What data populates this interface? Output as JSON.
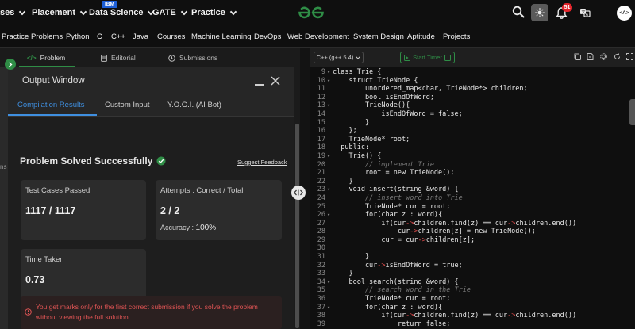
{
  "topnav": {
    "items": [
      {
        "label": "ses",
        "has_chevron": true
      },
      {
        "label": "Placement",
        "has_chevron": true
      },
      {
        "label": "Data Science",
        "has_chevron": true,
        "badge": "IBM"
      },
      {
        "label": "GATE",
        "has_chevron": true
      },
      {
        "label": "Practice",
        "has_chevron": true
      }
    ],
    "notification_count": "51",
    "avatar_text": "<A>"
  },
  "categories": [
    "Practice Problems",
    "Python",
    "C",
    "C++",
    "Java",
    "Courses",
    "Machine Learning",
    "DevOps",
    "Web Development",
    "System Design",
    "Aptitude",
    "Projects"
  ],
  "problem_tabs": {
    "problem": "Problem",
    "editorial": "Editorial",
    "submissions": "Submissions"
  },
  "side_strip_text": "ns",
  "output_window": {
    "title": "Output Window",
    "tabs": [
      "Compilation Results",
      "Custom Input",
      "Y.O.G.I. (AI Bot)"
    ],
    "active_tab": 0,
    "status": "Problem Solved Successfully",
    "feedback_link": "Suggest Feedback",
    "test_cases": {
      "label": "Test Cases Passed",
      "value": "1117 / 1117"
    },
    "attempts": {
      "label": "Attempts : Correct / Total",
      "value": "2 / 2",
      "accuracy_label": "Accuracy :",
      "accuracy_value": "100%"
    },
    "time_taken": {
      "label": "Time Taken",
      "value": "0.73"
    },
    "warning": "You get marks only for the first correct submission if you solve the problem without viewing the full solution."
  },
  "editor": {
    "language": "C++ (g++ 5.4)",
    "timer_label": "Start Timer",
    "lines": [
      {
        "n": "9",
        "fold": true,
        "text": "class Trie {"
      },
      {
        "n": "10",
        "fold": true,
        "text": "    struct TrieNode {"
      },
      {
        "n": "11",
        "fold": false,
        "text": "        unordered_map<char, TrieNode*> children;"
      },
      {
        "n": "12",
        "fold": false,
        "text": "        bool isEndOfWord;"
      },
      {
        "n": "13",
        "fold": true,
        "text": "        TrieNode(){"
      },
      {
        "n": "14",
        "fold": false,
        "text": "            isEndOfWord = false;"
      },
      {
        "n": "15",
        "fold": false,
        "text": "        }"
      },
      {
        "n": "16",
        "fold": false,
        "text": "    };"
      },
      {
        "n": "17",
        "fold": false,
        "text": "    TrieNode* root;"
      },
      {
        "n": "18",
        "fold": false,
        "text": "  public:"
      },
      {
        "n": "19",
        "fold": true,
        "text": "    Trie() {"
      },
      {
        "n": "20",
        "fold": false,
        "text": "        // implement Trie"
      },
      {
        "n": "21",
        "fold": false,
        "text": "        root = new TrieNode();"
      },
      {
        "n": "22",
        "fold": false,
        "text": "    }"
      },
      {
        "n": "23",
        "fold": true,
        "text": "    void insert(string &word) {"
      },
      {
        "n": "24",
        "fold": false,
        "text": "        // insert word into Trie"
      },
      {
        "n": "25",
        "fold": false,
        "text": "        TrieNode* cur = root;"
      },
      {
        "n": "26",
        "fold": true,
        "text": "        for(char z : word){"
      },
      {
        "n": "27",
        "fold": false,
        "text": "            if(cur->children.find(z) == cur->children.end())"
      },
      {
        "n": "28",
        "fold": false,
        "text": "                cur->children[z] = new TrieNode();"
      },
      {
        "n": "29",
        "fold": false,
        "text": "            cur = cur->children[z];"
      },
      {
        "n": "30",
        "fold": false,
        "text": ""
      },
      {
        "n": "31",
        "fold": false,
        "text": "        }"
      },
      {
        "n": "32",
        "fold": false,
        "text": "        cur->isEndOfWord = true;"
      },
      {
        "n": "33",
        "fold": false,
        "text": "    }"
      },
      {
        "n": "34",
        "fold": true,
        "text": "    bool search(string &word) {"
      },
      {
        "n": "35",
        "fold": false,
        "text": "        // search word in the Trie"
      },
      {
        "n": "36",
        "fold": false,
        "text": "        TrieNode* cur = root;"
      },
      {
        "n": "37",
        "fold": true,
        "text": "        for(char z : word){"
      },
      {
        "n": "38",
        "fold": false,
        "text": "            if(cur->children.find(z) == cur->children.end())"
      },
      {
        "n": "39",
        "fold": false,
        "text": "                return false;"
      }
    ]
  },
  "colors": {
    "brand_green": "#2f8d46",
    "accent_blue": "#3f8fe0",
    "warning_red": "#e05454",
    "notification_red": "#e3242b"
  }
}
